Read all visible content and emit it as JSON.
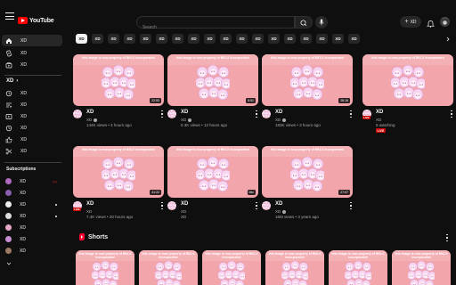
{
  "header": {
    "logo_text": "YouTube",
    "search_placeholder": "Search",
    "create_label": "XD"
  },
  "sidebar": {
    "top_items": [
      {
        "label": "XD",
        "icon": "home-icon",
        "active": true
      },
      {
        "label": "XD",
        "icon": "shorts-icon"
      },
      {
        "label": "XD",
        "icon": "subscriptions-icon"
      }
    ],
    "you_title": "XD",
    "you_items": [
      {
        "label": "XD",
        "icon": "history-icon"
      },
      {
        "label": "XD",
        "icon": "playlists-icon"
      },
      {
        "label": "XD",
        "icon": "your-videos-icon"
      },
      {
        "label": "XD",
        "icon": "watch-later-icon"
      },
      {
        "label": "XD",
        "icon": "liked-videos-icon"
      },
      {
        "label": "XD",
        "icon": "clips-icon"
      }
    ],
    "subscriptions_title": "Subscriptions",
    "subscriptions": [
      {
        "label": "XD",
        "indicator": "live"
      },
      {
        "label": "XD",
        "indicator": "none"
      },
      {
        "label": "XD",
        "indicator": "dot"
      },
      {
        "label": "XD",
        "indicator": "dot"
      },
      {
        "label": "XD",
        "indicator": "none"
      },
      {
        "label": "XD",
        "indicator": "none"
      },
      {
        "label": "XD",
        "indicator": "none"
      }
    ]
  },
  "chips": [
    "XD",
    "XD",
    "XD",
    "XD",
    "XD",
    "XD",
    "XD",
    "XD",
    "XD",
    "XD",
    "XD",
    "XD",
    "XD",
    "XD",
    "XD",
    "XD",
    "XD",
    "XD"
  ],
  "thumb_caption": "this image is now property of BKLX Incorporated",
  "videos": [
    {
      "title": "XD",
      "channel": "XD",
      "verified": true,
      "stats": "144K views • 4 hours ago",
      "duration": "22:53",
      "channel_live": false
    },
    {
      "title": "XD",
      "channel": "XD",
      "verified": true,
      "stats": "5.3K views • 13 hours ago",
      "duration": "8:51",
      "channel_live": false
    },
    {
      "title": "XD",
      "channel": "XD",
      "verified": true,
      "stats": "183K views • 3 hours ago",
      "duration": "28:16",
      "channel_live": false
    },
    {
      "title": "XD",
      "channel": "XD",
      "verified": false,
      "stats": "5 watching",
      "duration": "",
      "live_tag": "LIVE",
      "channel_live": true
    },
    {
      "title": "XD",
      "channel": "XD",
      "verified": false,
      "stats": "7.4K views • 20 hours ago",
      "duration": "41:22",
      "channel_live": true
    },
    {
      "title": "XD",
      "channel": "XD",
      "verified": false,
      "stats": "XD",
      "duration": "Mix",
      "channel_live": false
    },
    {
      "title": "XD",
      "channel": "XD",
      "verified": true,
      "stats": "16M views • 3 years ago",
      "duration": "27:07",
      "channel_live": false
    }
  ],
  "shorts": {
    "title": "Shorts",
    "count": 6
  },
  "colors": {
    "background": "#0f0f0f",
    "thumbnail": "#f2a5aa",
    "accent": "#ff0000"
  }
}
